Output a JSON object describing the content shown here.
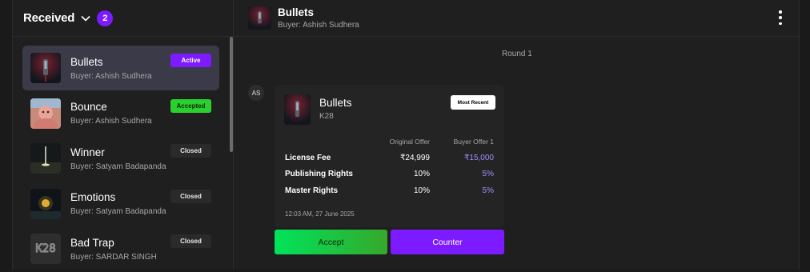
{
  "left_header": {
    "title": "Received",
    "count": "2"
  },
  "offers": [
    {
      "title": "Bullets",
      "buyer": "Buyer: Ashish Sudhera",
      "status": "Active"
    },
    {
      "title": "Bounce",
      "buyer": "Buyer: Ashish Sudhera",
      "status": "Accepted"
    },
    {
      "title": "Winner",
      "buyer": "Buyer: Satyam Badapanda",
      "status": "Closed"
    },
    {
      "title": "Emotions",
      "buyer": "Buyer: Satyam Badapanda",
      "status": "Closed"
    },
    {
      "title": "Bad Trap",
      "buyer": "Buyer: SARDAR SINGH",
      "status": "Closed",
      "thumb_text": "K28"
    }
  ],
  "detail_header": {
    "title": "Bullets",
    "buyer": "Buyer: Ashish Sudhera"
  },
  "round_label": "Round 1",
  "sender_initials": "AS",
  "offer_card": {
    "title": "Bullets",
    "subtitle": "K28",
    "badge": "Most Recent",
    "col_original": "Original Offer",
    "col_buyer": "Buyer Offer 1",
    "rows": [
      {
        "label": "License Fee",
        "original": "₹24,999",
        "buyer": "₹15,000"
      },
      {
        "label": "Publishing Rights",
        "original": "10%",
        "buyer": "5%"
      },
      {
        "label": "Master Rights",
        "original": "10%",
        "buyer": "5%"
      }
    ],
    "timestamp": "12:03 AM, 27 June 2025"
  },
  "actions": {
    "accept": "Accept",
    "counter": "Counter"
  },
  "colors": {
    "accent": "#7c1bff",
    "accepted": "#2ad12e",
    "buyer_value": "#a58cff"
  }
}
